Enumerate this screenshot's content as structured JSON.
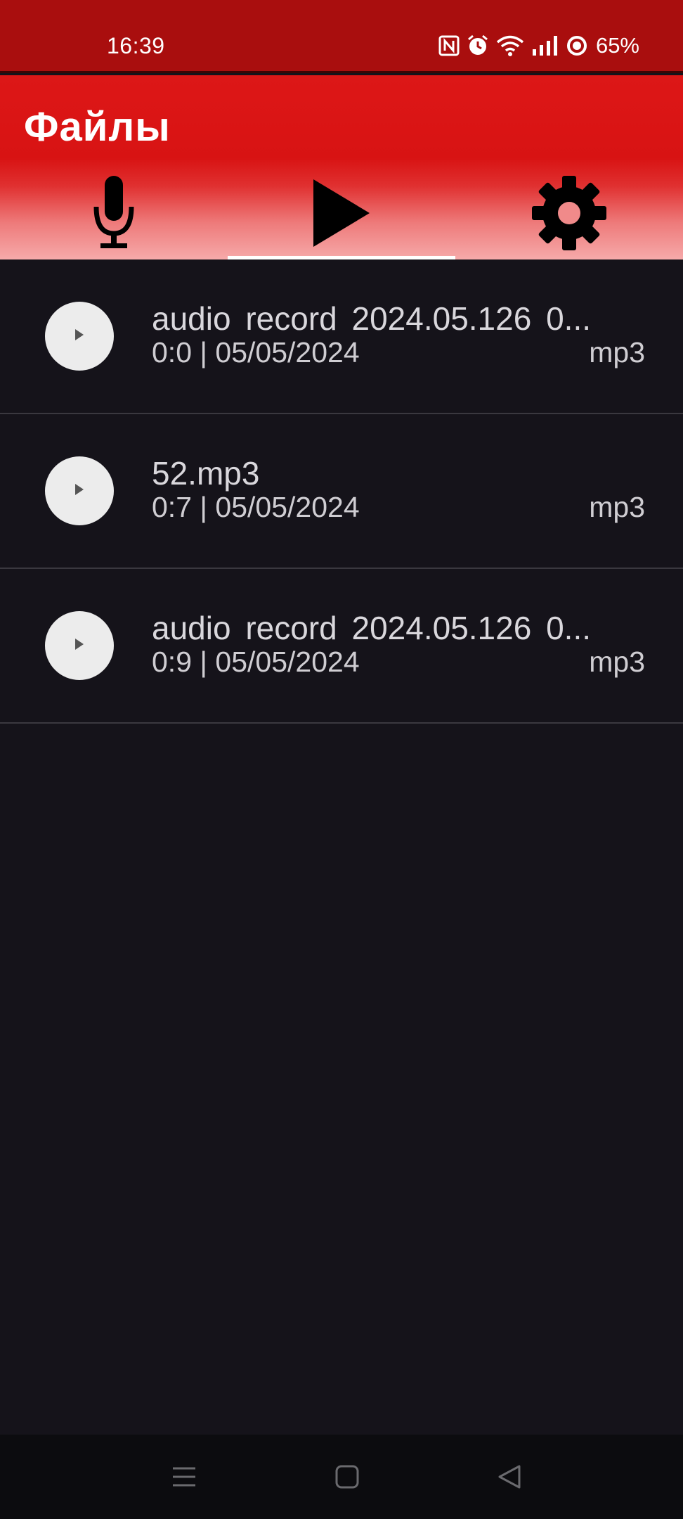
{
  "status_bar": {
    "time": "16:39",
    "battery": "65%",
    "icons": [
      "nfc-icon",
      "alarm-icon",
      "wifi-icon",
      "signal-icon",
      "battery-icon"
    ]
  },
  "app_bar": {
    "title": "Файлы",
    "tabs": [
      {
        "icon": "microphone-icon",
        "active": false
      },
      {
        "icon": "play-icon",
        "active": true
      },
      {
        "icon": "gear-icon",
        "active": false
      }
    ]
  },
  "files": [
    {
      "title": "audio record 2024.05.126 0...",
      "meta": "0:0 | 05/05/2024",
      "ext": "mp3"
    },
    {
      "title": "52.mp3",
      "meta": "0:7 | 05/05/2024",
      "ext": "mp3"
    },
    {
      "title": "audio record 2024.05.126 0...",
      "meta": "0:9 | 05/05/2024",
      "ext": "mp3"
    }
  ],
  "nav_bar": {
    "buttons": [
      "menu-icon",
      "home-icon",
      "back-icon"
    ]
  },
  "colors": {
    "status_bar": "#a90e0e",
    "app_bar": "#dd1717",
    "background": "#15131a",
    "text": "#d9d7dc"
  }
}
